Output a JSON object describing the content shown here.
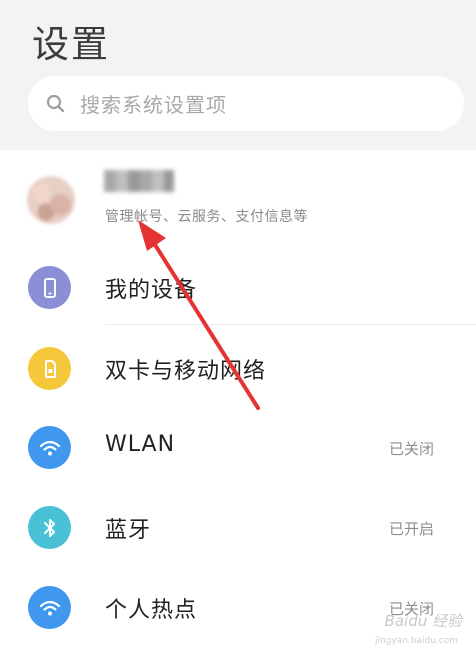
{
  "header": {
    "title": "设置"
  },
  "search": {
    "placeholder": "搜索系统设置项"
  },
  "account": {
    "subtitle": "管理帐号、云服务、支付信息等"
  },
  "items": [
    {
      "label": "我的设备",
      "status": "",
      "icon": "phone-icon",
      "color": "#8b8fd6"
    },
    {
      "label": "双卡与移动网络",
      "status": "",
      "icon": "sim-card-icon",
      "color": "#f5c83b"
    },
    {
      "label": "WLAN",
      "status": "已关闭",
      "icon": "wifi-icon",
      "color": "#3f97ee"
    },
    {
      "label": "蓝牙",
      "status": "已开启",
      "icon": "bluetooth-icon",
      "color": "#48c1d6"
    },
    {
      "label": "个人热点",
      "status": "已关闭",
      "icon": "hotspot-icon",
      "color": "#3f97ee"
    }
  ],
  "watermark": {
    "brand": "Baidu 经验",
    "url": "jingyan.baidu.com"
  },
  "annotation": {
    "color": "#e53333"
  }
}
